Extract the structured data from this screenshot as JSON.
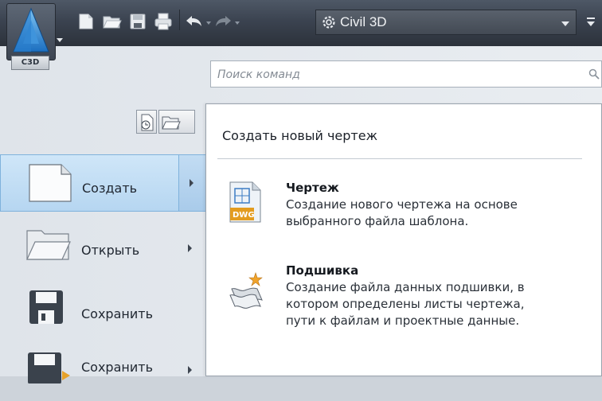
{
  "app": {
    "badge": "C3D",
    "workspace": "Civil 3D"
  },
  "qat": {
    "icons": [
      "new-icon",
      "open-icon",
      "save-icon",
      "print-icon",
      "undo-icon",
      "redo-icon"
    ]
  },
  "search": {
    "placeholder": "Поиск команд"
  },
  "menu": {
    "items": [
      {
        "label": "Создать",
        "icon": "new-document-icon",
        "active": true,
        "has_submenu": true
      },
      {
        "label": "Открыть",
        "icon": "open-folder-icon",
        "active": false,
        "has_submenu": true
      },
      {
        "label": "Сохранить",
        "icon": "save-disk-icon",
        "active": false,
        "has_submenu": false
      },
      {
        "label": "Сохранить",
        "icon": "save-as-icon",
        "active": false,
        "has_submenu": true
      }
    ]
  },
  "submenu": {
    "title": "Создать новый чертеж",
    "entries": [
      {
        "title": "Чертеж",
        "description": "Создание нового чертежа на основе\nвыбранного файла шаблона.",
        "icon": "dwg-icon"
      },
      {
        "title": "Подшивка",
        "description": "Создание файла данных подшивки, в\nкотором определены листы чертежа,\nпути к файлам и проектные данные.",
        "icon": "sheet-set-icon"
      }
    ]
  },
  "colors": {
    "titlebar": "#3b4350",
    "active_item": "#b6d6f1",
    "panel": "#ffffff"
  }
}
